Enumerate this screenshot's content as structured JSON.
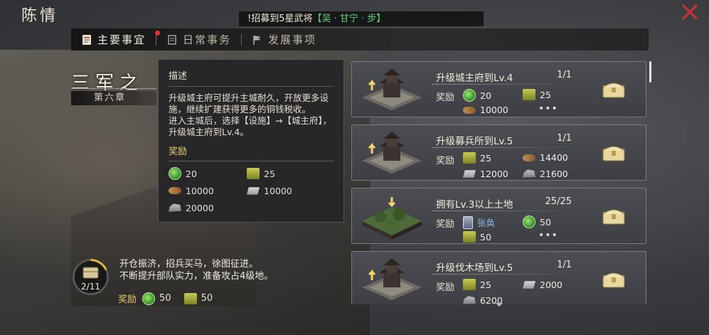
{
  "window": {
    "title": "陈情",
    "close_icon": "close-x-icon",
    "accent": "#c8313a"
  },
  "marquee": {
    "prefix": "!招募到5星武将",
    "highlight": "【吴 · 甘宁 · 步】",
    "highlight_color": "#5bd07a"
  },
  "tabs": [
    {
      "label": "主要事宜",
      "icon": "scroll-icon",
      "active": true,
      "badge": true
    },
    {
      "label": "日常事务",
      "icon": "calendar-icon",
      "active": false
    },
    {
      "label": "发展事项",
      "icon": "flag-icon",
      "active": false
    }
  ],
  "chapter": {
    "title": "三军之",
    "subtitle": "第六章"
  },
  "tooltip": {
    "heading": "描述",
    "body": "升级城主府可提升主城耐久，开放更多设施，继续扩建获得更多的铜钱税收。\n进入主城后，选择【设施】→【城主府】，升级城主府到Lv.4。",
    "reward_heading": "奖励",
    "rewards": [
      {
        "icon": "jade-icon",
        "value": "20"
      },
      {
        "icon": "grain-icon",
        "value": "25"
      },
      {
        "icon": "wood-icon",
        "value": "10000"
      },
      {
        "icon": "iron-icon",
        "value": "10000"
      },
      {
        "icon": "stone-icon",
        "value": "20000"
      }
    ]
  },
  "progress": {
    "text": "2/11",
    "fraction": 0.18
  },
  "story": {
    "text": "开仓振济，招兵买马，徐图征进。\n不断提升部队实力，准备攻占4级地。"
  },
  "chapter_reward": {
    "label": "奖励",
    "items": [
      {
        "icon": "jade-icon",
        "value": "50"
      },
      {
        "icon": "grain-icon",
        "value": "50"
      }
    ]
  },
  "quests": [
    {
      "title": "升级城主府到Lv.4",
      "progress": "1/1",
      "reward_label": "奖励",
      "thumb": "pagoda-upgrade",
      "rewards": [
        {
          "icon": "jade-icon",
          "value": "20"
        },
        {
          "icon": "grain-icon",
          "value": "25"
        },
        {
          "icon": "wood-icon",
          "value": "10000"
        }
      ],
      "more": "•••"
    },
    {
      "title": "升级募兵所到Lv.5",
      "progress": "1/1",
      "reward_label": "奖励",
      "thumb": "pagoda-upgrade",
      "rewards": [
        {
          "icon": "grain-icon",
          "value": "25"
        },
        {
          "icon": "wood-icon",
          "value": "14400"
        },
        {
          "icon": "iron-icon",
          "value": "12000"
        },
        {
          "icon": "stone-icon",
          "value": "21600"
        }
      ]
    },
    {
      "title": "拥有Lv.3以上土地",
      "progress": "25/25",
      "reward_label": "奖励",
      "thumb": "land-tile",
      "rewards": [
        {
          "icon": "card-icon",
          "value": "张奂"
        },
        {
          "icon": "jade-icon",
          "value": "50"
        },
        {
          "icon": "grain-icon",
          "value": "50"
        }
      ],
      "more": "•••"
    },
    {
      "title": "升级伐木场到Lv.5",
      "progress": "1/1",
      "reward_label": "奖励",
      "thumb": "pagoda-upgrade",
      "rewards": [
        {
          "icon": "grain-icon",
          "value": "25"
        },
        {
          "icon": "iron-icon",
          "value": "2000"
        },
        {
          "icon": "stone-icon",
          "value": "6200"
        }
      ]
    }
  ]
}
